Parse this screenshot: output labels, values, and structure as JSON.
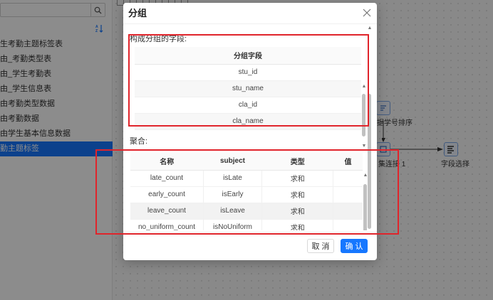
{
  "sidebar": {
    "search_placeholder": "",
    "items": [
      "生考勤主题标签表",
      "由_考勤类型表",
      "由_学生考勤表",
      "由_学生信息表",
      "由考勤类型数据",
      "由考勤数据",
      "由学生基本信息数据",
      "勤主题标签"
    ],
    "active_index": 7
  },
  "canvas": {
    "node_sort_label": "据学号排序",
    "node_join_label": "集连接 1",
    "node_select_label": "字段选择"
  },
  "modal": {
    "title": "分组",
    "group_section_label": "构成分组的字段:",
    "group_table": {
      "header": "分组字段",
      "rows": [
        "stu_id",
        "stu_name",
        "cla_id",
        "cla_name"
      ]
    },
    "agg_section_label": "聚合:",
    "agg_table": {
      "headers": [
        "名称",
        "subject",
        "类型",
        "值"
      ],
      "rows": [
        {
          "name": "late_count",
          "subject": "isLate",
          "type": "求和",
          "value": ""
        },
        {
          "name": "early_count",
          "subject": "isEarly",
          "type": "求和",
          "value": ""
        },
        {
          "name": "leave_count",
          "subject": "isLeave",
          "type": "求和",
          "value": ""
        },
        {
          "name": "no_uniform_count",
          "subject": "isNoUniform",
          "type": "求和",
          "value": ""
        }
      ]
    },
    "cancel_label": "取 消",
    "ok_label": "确 认"
  },
  "colors": {
    "primary": "#1677ff",
    "annotation": "#e0242b"
  }
}
